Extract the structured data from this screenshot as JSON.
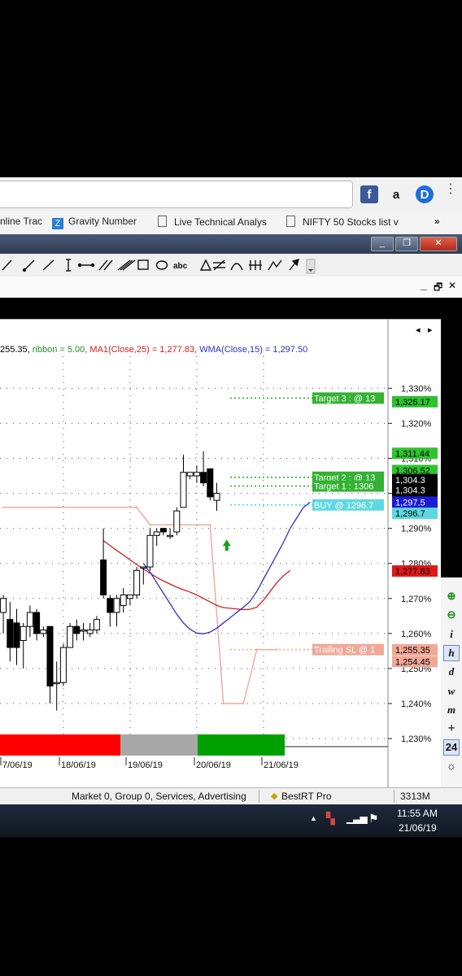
{
  "browser": {
    "bookmarks": [
      {
        "label": "nline Trac"
      },
      {
        "label": "Gravity Number"
      },
      {
        "label": "Live Technical Analys"
      },
      {
        "label": "NIFTY 50 Stocks list v"
      }
    ],
    "more_label": "»"
  },
  "window": {
    "minimize": "_",
    "restore": "❐",
    "close": "✕"
  },
  "mdi": {
    "minimize": "_",
    "restore": "🗗",
    "close": "✕"
  },
  "chart": {
    "header_parts": [
      {
        "text": "255.35, ",
        "color": "#000000"
      },
      {
        "text": "ribbon = 5.00, ",
        "color": "#2a8a2a"
      },
      {
        "text": "MA1(Close,25) = 1,277.83, ",
        "color": "#d02020"
      },
      {
        "text": "WMA(Close,15) = 1,297.50",
        "color": "#3030c0"
      }
    ],
    "scroll_left": "◂",
    "scroll_right": "▸",
    "annotations": [
      {
        "label": "Target 3 : @ 13",
        "price": 1327.2,
        "color": "#33b233"
      },
      {
        "label": "Target 2 : @ 13",
        "price": 1304.6,
        "color": "#33b233"
      },
      {
        "label": "Target 1 : 1306",
        "price": 1302.1,
        "color": "#33b233"
      },
      {
        "label": "BUY @ 1296.7",
        "price": 1296.7,
        "color": "#5fd8e0"
      },
      {
        "label": "Trailing SL @ 1",
        "price": 1255.4,
        "color": "#f0a898"
      }
    ],
    "markers": [
      {
        "label": "1,326.17",
        "price": 1326.17,
        "bg": "#2fc22f",
        "fg": "#000000"
      },
      {
        "label": "1,311.44",
        "price": 1311.44,
        "bg": "#2fc22f",
        "fg": "#000000"
      },
      {
        "label": "1,306.52",
        "price": 1306.52,
        "bg": "#2fc22f",
        "fg": "#000000"
      },
      {
        "label": "1,304.3",
        "price": 1303.9,
        "bg": "#000000",
        "fg": "#ffffff"
      },
      {
        "label": "1,304.3",
        "price": 1300.9,
        "bg": "#000000",
        "fg": "#ffffff"
      },
      {
        "label": "1,304.3",
        "price": 1297.9,
        "bg": "#000000",
        "fg": "#ffffff"
      },
      {
        "label": "1,304.3",
        "price": 1294.9,
        "bg": "#000000",
        "fg": "#ffffff"
      },
      {
        "label": "1,297.5",
        "price": 1297.5,
        "bg": "#1c1cd8",
        "fg": "#ffffff"
      },
      {
        "label": "1,296.7",
        "price": 1294.3,
        "bg": "#5fd8e0",
        "fg": "#000000"
      },
      {
        "label": "1,277.83",
        "price": 1277.83,
        "bg": "#e01818",
        "fg": "#000000"
      },
      {
        "label": "1,255.35",
        "price": 1255.35,
        "bg": "#f0a898",
        "fg": "#000000"
      },
      {
        "label": "1,254.45",
        "price": 1252.0,
        "bg": "#f0a898",
        "fg": "#000000"
      }
    ],
    "ribbon": [
      {
        "color": "#ff0000"
      },
      {
        "color": "#a8a8a8"
      },
      {
        "color": "#00a000"
      }
    ],
    "buy_arrow_color": "#1e9e1e"
  },
  "chart_data": {
    "type": "candlestick",
    "y_ticks": [
      "1,330%",
      "1,320%",
      "1,310%",
      "1,300%",
      "1,290%",
      "1,280%",
      "1,270%",
      "1,260%",
      "1,250%",
      "1,240%",
      "1,230%"
    ],
    "y_tick_values": [
      1330,
      1320,
      1310,
      1300,
      1290,
      1280,
      1270,
      1260,
      1250,
      1240,
      1230
    ],
    "ylim": [
      1227,
      1341
    ],
    "x_labels": [
      "7/06/19",
      "18/06/19",
      "19/06/19",
      "20/06/19",
      "21/06/19"
    ],
    "x_label_bars": [
      0.5,
      10.5,
      19.5,
      29.5,
      39.5
    ],
    "candles": [
      {
        "o": 1266,
        "h": 1271,
        "l": 1260,
        "c": 1270
      },
      {
        "o": 1264,
        "h": 1269,
        "l": 1252,
        "c": 1256
      },
      {
        "o": 1263,
        "h": 1267,
        "l": 1251,
        "c": 1256
      },
      {
        "o": 1258,
        "h": 1263,
        "l": 1250,
        "c": 1262
      },
      {
        "o": 1262,
        "h": 1268,
        "l": 1259,
        "c": 1266
      },
      {
        "o": 1266,
        "h": 1267,
        "l": 1258,
        "c": 1260
      },
      {
        "o": 1260,
        "h": 1262,
        "l": 1259,
        "c": 1261
      },
      {
        "o": 1262,
        "h": 1262,
        "l": 1240,
        "c": 1245
      },
      {
        "o": 1246,
        "h": 1252,
        "l": 1238,
        "c": 1246
      },
      {
        "o": 1246,
        "h": 1257,
        "l": 1245,
        "c": 1256
      },
      {
        "o": 1256,
        "h": 1263,
        "l": 1256,
        "c": 1262
      },
      {
        "o": 1262,
        "h": 1264,
        "l": 1258,
        "c": 1260
      },
      {
        "o": 1261,
        "h": 1263,
        "l": 1258,
        "c": 1261
      },
      {
        "o": 1260,
        "h": 1263,
        "l": 1259,
        "c": 1261
      },
      {
        "o": 1261,
        "h": 1265,
        "l": 1260,
        "c": 1264
      },
      {
        "o": 1281,
        "h": 1290,
        "l": 1270,
        "c": 1271
      },
      {
        "o": 1270,
        "h": 1271,
        "l": 1262,
        "c": 1266
      },
      {
        "o": 1266,
        "h": 1271,
        "l": 1262,
        "c": 1270
      },
      {
        "o": 1268,
        "h": 1273,
        "l": 1266,
        "c": 1271
      },
      {
        "o": 1270,
        "h": 1271,
        "l": 1268,
        "c": 1271
      },
      {
        "o": 1271,
        "h": 1279,
        "l": 1270,
        "c": 1278
      },
      {
        "o": 1279,
        "h": 1279,
        "l": 1274,
        "c": 1279
      },
      {
        "o": 1279,
        "h": 1290,
        "l": 1278,
        "c": 1288
      },
      {
        "o": 1288,
        "h": 1290,
        "l": 1285,
        "c": 1289
      },
      {
        "o": 1290,
        "h": 1290,
        "l": 1288,
        "c": 1289
      },
      {
        "o": 1288,
        "h": 1290,
        "l": 1287,
        "c": 1288
      },
      {
        "o": 1289,
        "h": 1296,
        "l": 1288,
        "c": 1295
      },
      {
        "o": 1296,
        "h": 1311,
        "l": 1296,
        "c": 1306
      },
      {
        "o": 1305,
        "h": 1306,
        "l": 1304,
        "c": 1306
      },
      {
        "o": 1305,
        "h": 1308,
        "l": 1303,
        "c": 1306
      },
      {
        "o": 1306,
        "h": 1312,
        "l": 1302,
        "c": 1303
      },
      {
        "o": 1307,
        "h": 1307,
        "l": 1298,
        "c": 1299
      },
      {
        "o": 1298,
        "h": 1303,
        "l": 1295,
        "c": 1300
      }
    ],
    "series": [
      {
        "name": "MA1(Close,25)",
        "color": "#d02020",
        "values": [
          1286.5,
          1285.1,
          1283.7,
          1282.4,
          1281.0,
          1279.7,
          1278.4,
          1277.2,
          1276.0,
          1275.0,
          1274.1,
          1273.2,
          1272.5,
          1271.8,
          1271.0,
          1270.0,
          1269.0,
          1268.0,
          1267.4,
          1267.2,
          1267.0,
          1266.8,
          1266.9,
          1267.5,
          1269.5,
          1272.0,
          1274.5,
          1276.5,
          1278.0
        ]
      },
      {
        "name": "WMA(Close,15)",
        "color": "#3030c0",
        "values": [
          1280.0,
          1277.5,
          1274.5,
          1271.5,
          1268.5,
          1265.5,
          1263.0,
          1261.2,
          1260.1,
          1259.9,
          1260.4,
          1261.5,
          1263.0,
          1264.5,
          1266.0,
          1267.5,
          1269.2,
          1272.0,
          1275.5,
          1279.0,
          1282.5,
          1286.0,
          1290.0,
          1293.0,
          1296.0,
          1297.5
        ]
      }
    ]
  },
  "side_toolbar": [
    "⊕",
    "⊖",
    "i",
    "h",
    "d",
    "w",
    "m",
    "+",
    "24",
    "☼"
  ],
  "status": {
    "main": "Market 0, Group 0, Services, Advertising",
    "plugin": "BestRT Pro",
    "memory": "3313M"
  },
  "taskbar": {
    "time": "11:55 AM",
    "date": "21/06/19"
  }
}
